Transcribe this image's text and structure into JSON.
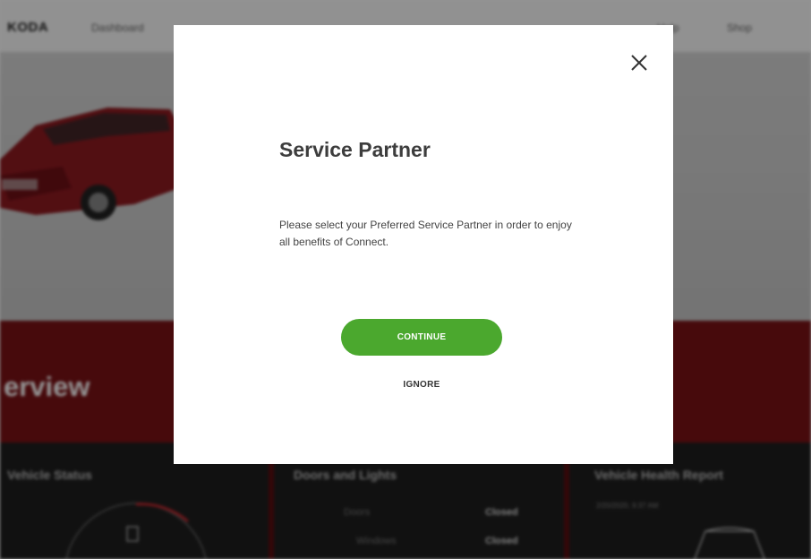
{
  "header": {
    "brand": "KODA",
    "nav": {
      "dashboard": "Dashboard",
      "help": "Help",
      "shop": "Shop"
    }
  },
  "hero": {
    "title": "erview"
  },
  "panels": {
    "vehicle_status": {
      "title": "Vehicle Status"
    },
    "doors_lights": {
      "title": "Doors and Lights",
      "rows": [
        {
          "label": "Doors",
          "value": "Closed"
        },
        {
          "label": "Windows",
          "value": "Closed"
        }
      ]
    },
    "health_report": {
      "title": "Vehicle Health Report",
      "date": "2/20/2020, 9:37 AM"
    }
  },
  "modal": {
    "title": "Service Partner",
    "message": "Please select your Preferred Service Partner in order to enjoy all benefits of Connect.",
    "continue_label": "CONTINUE",
    "ignore_label": "IGNORE",
    "close_icon": "close-icon"
  },
  "colors": {
    "accent_green": "#4ba82e",
    "brand_red": "#7a1216"
  }
}
